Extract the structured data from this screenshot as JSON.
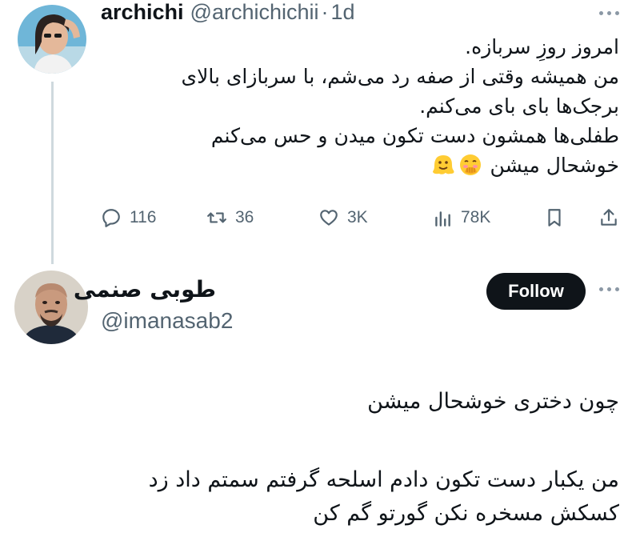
{
  "tweet": {
    "author_name": "archichi",
    "author_handle": "@archichichii",
    "separator": "·",
    "time": "1d",
    "body_lines": [
      "امروز روزِ سربازه.",
      "من همیشه وقتی از صفه رد می‌شم، با سربازای بالای",
      "برجک‌ها بای بای می‌کنم.",
      "طفلی‌ها همشون دست تکون میدن و حس می‌کنم",
      "خوشحال میشن"
    ],
    "emojis": [
      "hand-over-mouth-emoji",
      "melting-face-emoji"
    ],
    "stats": {
      "replies": "116",
      "retweets": "36",
      "likes": "3K",
      "views": "78K"
    }
  },
  "reply": {
    "author_name": "طوبی صنمی",
    "author_handle": "@imanasab2",
    "follow_label": "Follow",
    "body_lines": [
      "چون دختری خوشحال میشن",
      "من یکبار دست تکون دادم اسلحه گرفتم سمتم داد زد",
      "کسکش مسخره نکن گورتو گم کن"
    ]
  },
  "colors": {
    "text_primary": "#0f1419",
    "text_secondary": "#536471",
    "thread_line": "#cfd9de",
    "follow_bg": "#0f1419",
    "follow_text": "#ffffff"
  },
  "icons": [
    "reply-icon",
    "retweet-icon",
    "like-icon",
    "views-icon",
    "bookmark-icon",
    "share-icon",
    "more-icon"
  ]
}
